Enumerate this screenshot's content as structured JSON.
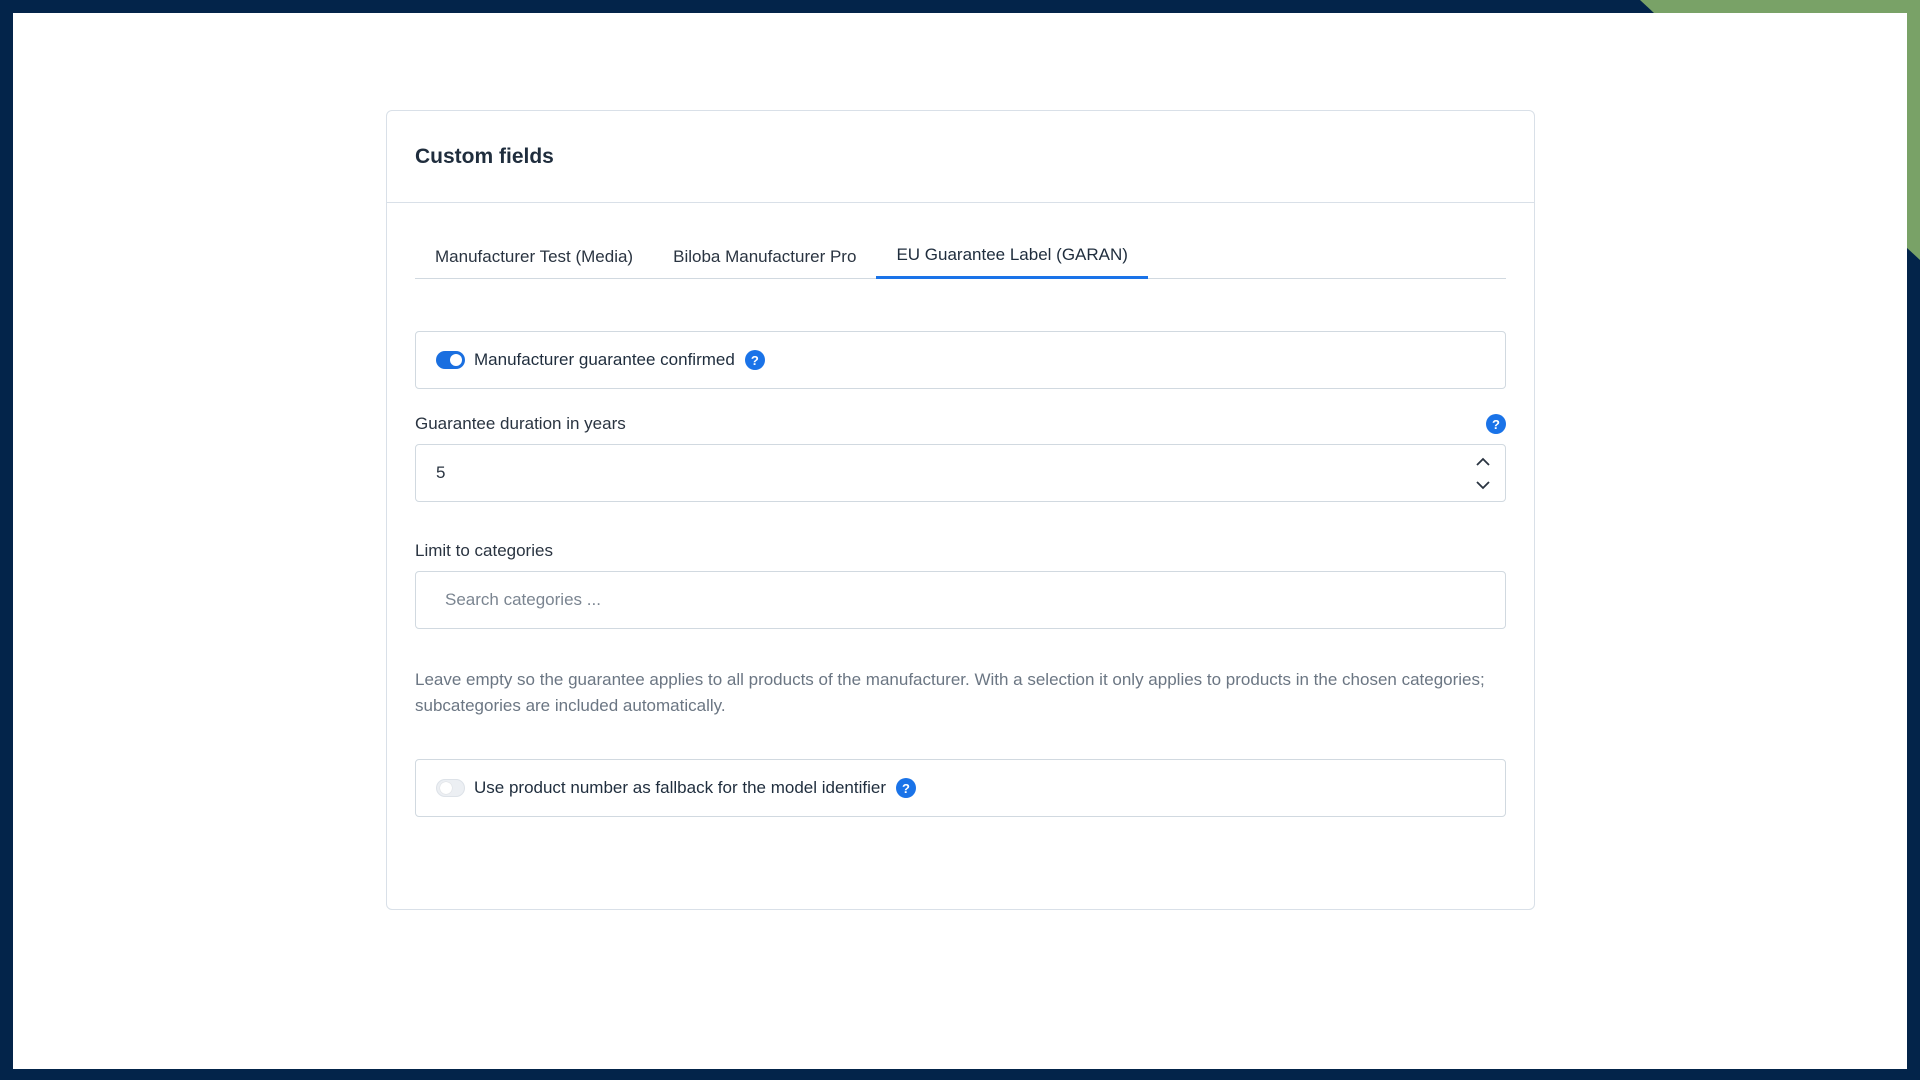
{
  "colors": {
    "accent": "#1a73e8",
    "frame": "#03244a",
    "corner_accent": "#79a267"
  },
  "card": {
    "title": "Custom fields"
  },
  "tabs": [
    {
      "label": "Manufacturer Test (Media)",
      "active": false
    },
    {
      "label": "Biloba Manufacturer Pro",
      "active": false
    },
    {
      "label": "EU Guarantee Label (GARAN)",
      "active": true
    }
  ],
  "guarantee_confirmed": {
    "label": "Manufacturer guarantee confirmed",
    "enabled": true,
    "help_icon": "question-icon",
    "help_glyph": "?"
  },
  "guarantee_duration": {
    "label": "Guarantee duration in years",
    "value": "5",
    "help_icon": "question-icon",
    "help_glyph": "?"
  },
  "categories": {
    "label": "Limit to categories",
    "placeholder": "Search categories ...",
    "help_text": "Leave empty so the guarantee applies to all products of the manufacturer. With a selection it only applies to products in the chosen categories; subcategories are included automatically."
  },
  "fallback": {
    "label": "Use product number as fallback for the model identifier",
    "enabled": false,
    "help_icon": "question-icon",
    "help_glyph": "?"
  }
}
